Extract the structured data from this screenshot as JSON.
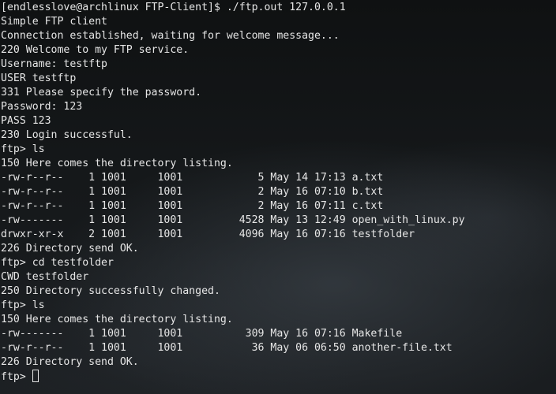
{
  "terminal": {
    "lines": [
      "[endlesslove@archlinux FTP-Client]$ ./ftp.out 127.0.0.1",
      "Simple FTP client",
      "Connection established, waiting for welcome message...",
      "220 Welcome to my FTP service.",
      "Username: testftp",
      "USER testftp",
      "331 Please specify the password.",
      "Password: 123",
      "PASS 123",
      "230 Login successful.",
      "ftp> ls",
      "150 Here comes the directory listing.",
      "-rw-r--r--    1 1001     1001            5 May 14 17:13 a.txt",
      "-rw-r--r--    1 1001     1001            2 May 16 07:10 b.txt",
      "-rw-r--r--    1 1001     1001            2 May 16 07:11 c.txt",
      "-rw-------    1 1001     1001         4528 May 13 12:49 open_with_linux.py",
      "drwxr-xr-x    2 1001     1001         4096 May 16 07:16 testfolder",
      "226 Directory send OK.",
      "ftp> cd testfolder",
      "CWD testfolder",
      "250 Directory successfully changed.",
      "ftp> ls",
      "150 Here comes the directory listing.",
      "-rw-------    1 1001     1001          309 May 16 07:16 Makefile",
      "-rw-r--r--    1 1001     1001           36 May 06 06:50 another-file.txt",
      "226 Directory send OK."
    ],
    "current_prompt": "ftp> ",
    "colors": {
      "text": "#e6e6e6",
      "background": "#15181a"
    }
  }
}
